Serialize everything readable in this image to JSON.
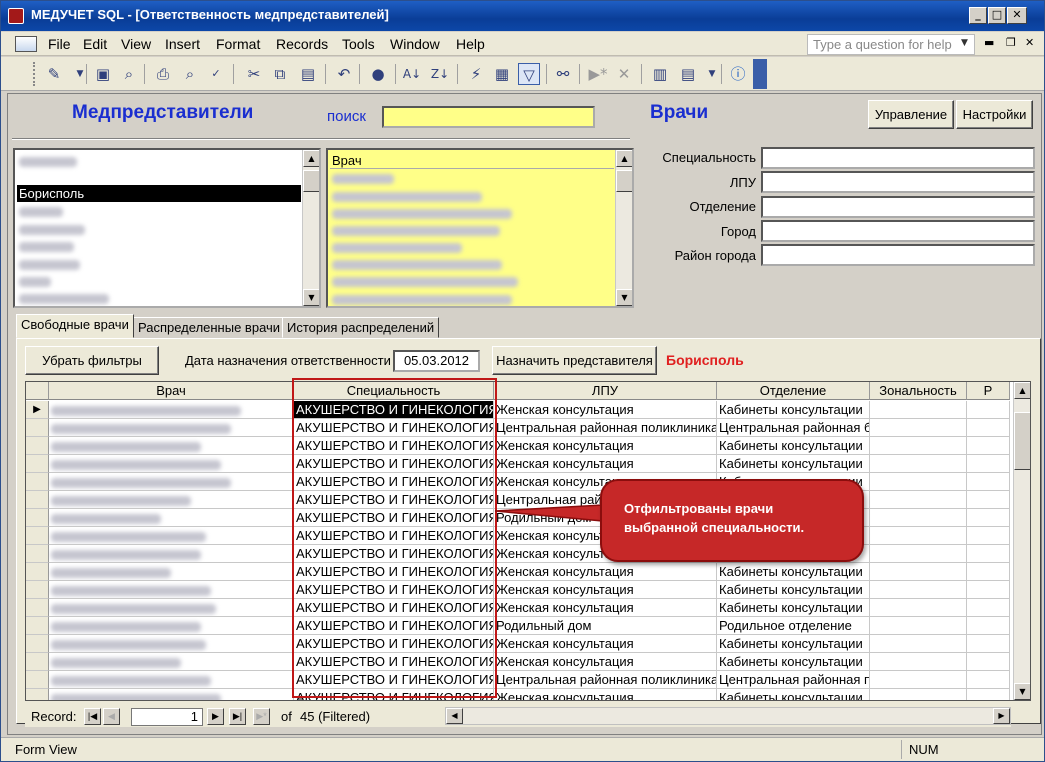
{
  "window": {
    "title": "МЕДУЧЕТ SQL - [Ответственность медпредставителей]",
    "min": "_",
    "max": "□",
    "close": "✕"
  },
  "menu": {
    "items": [
      "File",
      "Edit",
      "View",
      "Insert",
      "Format",
      "Records",
      "Tools",
      "Window",
      "Help"
    ],
    "help_placeholder": "Type a question for help"
  },
  "toolbar": {
    "icons": [
      "design-view-icon",
      "save-icon",
      "search-doc-icon",
      "print-icon",
      "print-preview-icon",
      "spelling-icon",
      "cut-icon",
      "copy-icon",
      "paste-icon",
      "undo-icon",
      "hyperlink-icon",
      "sort-ascending-icon",
      "sort-descending-icon",
      "filter-by-selection-icon",
      "filter-by-form-icon",
      "apply-filter-icon",
      "find-icon",
      "new-record-icon",
      "delete-record-icon",
      "database-window-icon",
      "new-object-icon",
      "help-icon"
    ]
  },
  "form": {
    "left_heading": "Медпредставители",
    "search_label": "поиск",
    "search_value": "",
    "right_heading": "Врачи",
    "btn_manage": "Управление",
    "btn_settings": "Настройки",
    "reps_list": {
      "items": [
        "",
        "Борисполь",
        "",
        "",
        "",
        "",
        "",
        ""
      ],
      "selected_index": 1
    },
    "doctors_list": {
      "header": "Врач",
      "items": [
        "",
        "",
        "",
        "",
        "",
        "",
        "",
        "",
        "",
        ""
      ]
    },
    "filters": [
      {
        "label": "Специальность",
        "value": ""
      },
      {
        "label": "ЛПУ",
        "value": ""
      },
      {
        "label": "Отделение",
        "value": ""
      },
      {
        "label": "Город",
        "value": ""
      },
      {
        "label": "Район города",
        "value": ""
      }
    ]
  },
  "tabs": [
    {
      "label": "Свободные врачи",
      "active": true
    },
    {
      "label": "Распределенные врачи",
      "active": false
    },
    {
      "label": "История распределений",
      "active": false
    }
  ],
  "tabpanel": {
    "btn_clear_filters": "Убрать фильтры",
    "date_label": "Дата назначения ответственности",
    "date_value": "05.03.2012",
    "btn_assign": "Назначить представителя",
    "assigned_rep": "Борисполь"
  },
  "grid": {
    "columns": [
      "Врач",
      "Специальность",
      "ЛПУ",
      "Отделение",
      "Зональность",
      "Р"
    ],
    "rows": [
      {
        "spec": "АКУШЕРСТВО И ГИНЕКОЛОГИЯ",
        "lpu": "Женская консультация",
        "dept": "Кабинеты консультации"
      },
      {
        "spec": "АКУШЕРСТВО И ГИНЕКОЛОГИЯ",
        "lpu": "Центральная районная поликлиника",
        "dept": "Центральная районная б"
      },
      {
        "spec": "АКУШЕРСТВО И ГИНЕКОЛОГИЯ",
        "lpu": "Женская консультация",
        "dept": "Кабинеты консультации"
      },
      {
        "spec": "АКУШЕРСТВО И ГИНЕКОЛОГИЯ",
        "lpu": "Женская консультация",
        "dept": "Кабинеты консультации"
      },
      {
        "spec": "АКУШЕРСТВО И ГИНЕКОЛОГИЯ",
        "lpu": "Женская консультация",
        "dept": "Кабинеты консультации"
      },
      {
        "spec": "АКУШЕРСТВО И ГИНЕКОЛОГИЯ",
        "lpu": "Центральная районная поликлиника",
        "dept": ""
      },
      {
        "spec": "АКУШЕРСТВО И ГИНЕКОЛОГИЯ",
        "lpu": "Родильный дом",
        "dept": "Родильное отделение"
      },
      {
        "spec": "АКУШЕРСТВО И ГИНЕКОЛОГИЯ",
        "lpu": "Женская консультация",
        "dept": ""
      },
      {
        "spec": "АКУШЕРСТВО И ГИНЕКОЛОГИЯ",
        "lpu": "Женская консультация",
        "dept": ""
      },
      {
        "spec": "АКУШЕРСТВО И ГИНЕКОЛОГИЯ",
        "lpu": "Женская консультация",
        "dept": "Кабинеты консультации"
      },
      {
        "spec": "АКУШЕРСТВО И ГИНЕКОЛОГИЯ",
        "lpu": "Женская консультация",
        "dept": "Кабинеты консультации"
      },
      {
        "spec": "АКУШЕРСТВО И ГИНЕКОЛОГИЯ",
        "lpu": "Женская консультация",
        "dept": "Кабинеты консультации"
      },
      {
        "spec": "АКУШЕРСТВО И ГИНЕКОЛОГИЯ",
        "lpu": "Родильный дом",
        "dept": "Родильное отделение"
      },
      {
        "spec": "АКУШЕРСТВО И ГИНЕКОЛОГИЯ",
        "lpu": "Женская консультация",
        "dept": "Кабинеты консультации"
      },
      {
        "spec": "АКУШЕРСТВО И ГИНЕКОЛОГИЯ",
        "lpu": "Женская консультация",
        "dept": "Кабинеты консультации"
      },
      {
        "spec": "АКУШЕРСТВО И ГИНЕКОЛОГИЯ",
        "lpu": "Центральная районная поликлиника",
        "dept": "Центральная районная п"
      },
      {
        "spec": "АКУШЕРСТВО И ГИНЕКОЛОГИЯ",
        "lpu": "Женская консультация",
        "dept": "Кабинеты консультации"
      }
    ]
  },
  "navigation": {
    "record_label": "Record:",
    "current": "1",
    "of_text": "of",
    "total_text": "45 (Filtered)"
  },
  "callout": "Отфильтрованы врачи выбранной специальности.",
  "status": {
    "left": "Form View",
    "right": "NUM"
  },
  "colors": {
    "title_bar": "#0a3d97",
    "heading_blue": "#1a2ed0",
    "search_yellow": "#ffff88",
    "alert_red": "#c62828"
  }
}
